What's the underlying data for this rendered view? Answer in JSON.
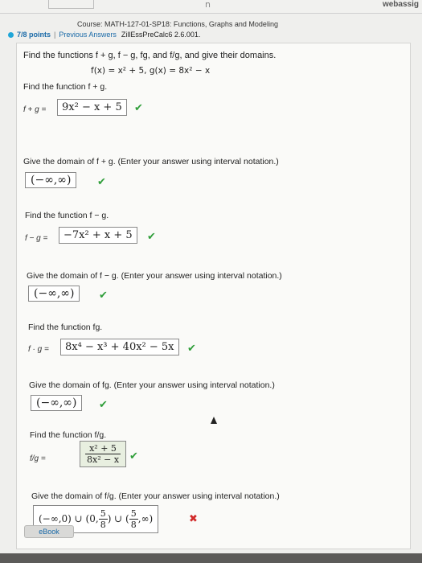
{
  "topbar": {
    "glyph": "n",
    "brand": "webassig"
  },
  "header": {
    "course": "Course: MATH-127-01-SP18: Functions, Graphs and Modeling",
    "points": "7/8 points",
    "separator": "|",
    "prev_answers": "Previous Answers",
    "assignment": "ZillEssPreCalc6 2.6.001."
  },
  "problem": {
    "prompt": "Find the functions f + g,  f − g,  fg, and f/g, and give their domains.",
    "defs": "f(x) = x² + 5,   g(x) = 8x² − x",
    "q1": "Find the function f + g.",
    "q1_label": "f + g =",
    "q1_answer": "9x² − x + 5",
    "q2": "Give the domain of f + g. (Enter your answer using interval notation.)",
    "q2_answer": "(−∞,∞)",
    "q3": "Find the function  f − g.",
    "q3_label": "f − g =",
    "q3_answer": "−7x² + x + 5",
    "q4": "Give the domain of f − g. (Enter your answer using interval notation.)",
    "q4_answer": "(−∞,∞)",
    "q5": "Find the function fg.",
    "q5_label": "f · g =",
    "q5_answer": "8x⁴ − x³ + 40x² − 5x",
    "q6": "Give the domain of fg. (Enter your answer using interval notation.)",
    "q6_answer": "(−∞,∞)",
    "q7": "Find the function f/g.",
    "q7_label": "f/g =",
    "q7_num": "x² + 5",
    "q7_den": "8x² − x",
    "q8": "Give the domain of f/g. (Enter your answer using interval notation.)",
    "q8_part1": "(−∞,0) ∪ (0,",
    "q8_frac1_n": "5",
    "q8_frac1_d": "8",
    "q8_part2": ") ∪ (",
    "q8_frac2_n": "5",
    "q8_frac2_d": "8",
    "q8_part3": ",∞)"
  },
  "marks": {
    "check": "✔",
    "cross": "✖"
  },
  "ebook": "eBook",
  "colors": {
    "check": "#2f9e3a",
    "cross": "#d12a2a",
    "link": "#1a6aa8"
  }
}
